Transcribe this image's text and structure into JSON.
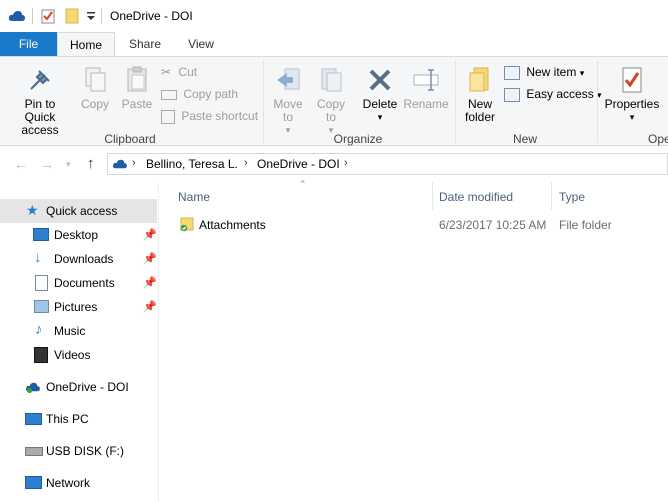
{
  "window": {
    "title": "OneDrive - DOI"
  },
  "ribbon_tabs": {
    "file": "File",
    "home": "Home",
    "share": "Share",
    "view": "View"
  },
  "clipboard": {
    "pin": "Pin to Quick access",
    "copy": "Copy",
    "paste": "Paste",
    "cut": "Cut",
    "copy_path": "Copy path",
    "paste_shortcut": "Paste shortcut",
    "group": "Clipboard"
  },
  "organize": {
    "move_to": "Move to",
    "copy_to": "Copy to",
    "delete": "Delete",
    "rename": "Rename",
    "group": "Organize"
  },
  "new": {
    "new_folder": "New folder",
    "new_item": "New item",
    "easy_access": "Easy access",
    "group": "New"
  },
  "open": {
    "properties": "Properties",
    "group": "Ope"
  },
  "address": {
    "crumbs": [
      "Bellino, Teresa L.",
      "OneDrive - DOI"
    ]
  },
  "nav": {
    "quick_access": "Quick access",
    "desktop": "Desktop",
    "downloads": "Downloads",
    "documents": "Documents",
    "pictures": "Pictures",
    "music": "Music",
    "videos": "Videos",
    "onedrive": "OneDrive - DOI",
    "this_pc": "This PC",
    "usb": "USB DISK (F:)",
    "network": "Network"
  },
  "columns": {
    "name": "Name",
    "date": "Date modified",
    "type": "Type"
  },
  "files": [
    {
      "name": "Attachments",
      "date": "6/23/2017 10:25 AM",
      "type": "File folder"
    }
  ],
  "colors": {
    "accent": "#1979ca",
    "folder": "#f8d775",
    "sync_green": "#3aa13a"
  }
}
